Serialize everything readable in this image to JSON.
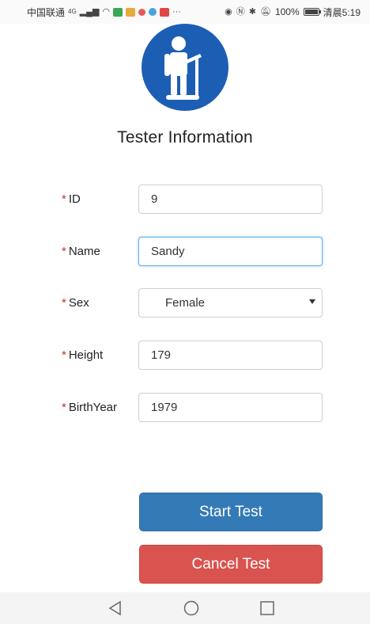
{
  "status_bar": {
    "carrier": "中国联通",
    "network": "4G",
    "battery_percent_text": "100%",
    "battery_level": 1.0,
    "time": "清晨5:19"
  },
  "logo": {
    "icon": "standing-person-with-cane-icon",
    "color": "#1d5eb5"
  },
  "page_title": "Tester Information",
  "form": {
    "required_mark": "*",
    "fields": {
      "id": {
        "label": "ID",
        "value": "9"
      },
      "name": {
        "label": "Name",
        "value": "Sandy"
      },
      "sex": {
        "label": "Sex",
        "value": "Female"
      },
      "height": {
        "label": "Height",
        "value": "179"
      },
      "birth_year": {
        "label": "BirthYear",
        "value": "1979"
      }
    }
  },
  "buttons": {
    "start": "Start Test",
    "cancel": "Cancel Test"
  },
  "nav_bar": {
    "back_icon": "triangle-back-icon",
    "home_icon": "circle-home-icon",
    "recents_icon": "square-recents-icon"
  },
  "colors": {
    "primary": "#337ab7",
    "danger": "#d9534f",
    "required": "#d9281e",
    "focus": "#66afe9"
  }
}
